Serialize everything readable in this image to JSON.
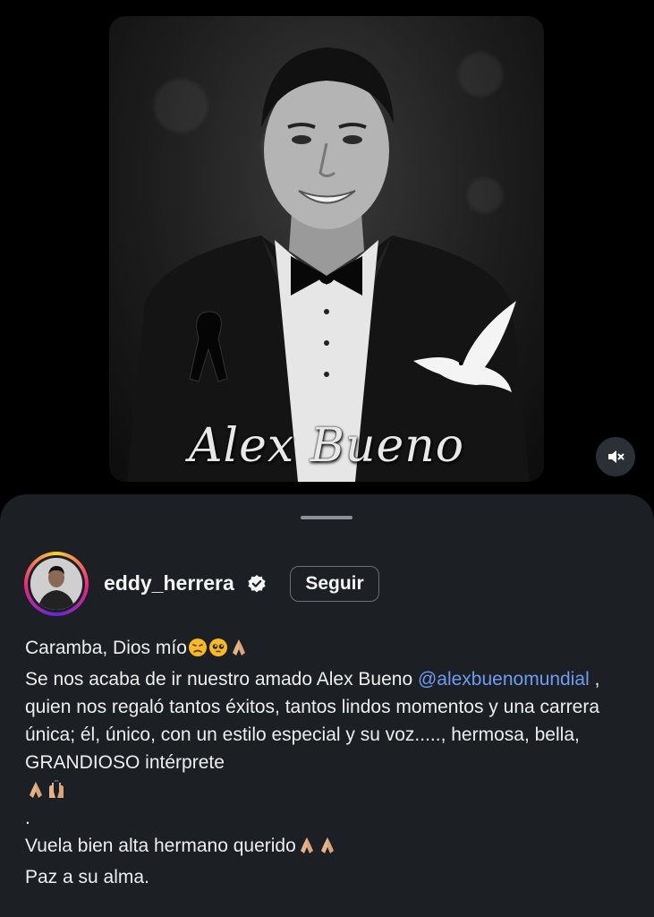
{
  "media": {
    "overlay_text": "Alex Bueno",
    "mute_icon": "speaker-muted-icon"
  },
  "post": {
    "username": "eddy_herrera",
    "verified_icon": "verified-badge-icon",
    "follow_label": "Seguir",
    "caption": {
      "line1": "Caramba, Dios mío",
      "line2_a": "Se nos acaba de ir nuestro amado Alex Bueno",
      "mention": "@alexbuenomundial",
      "line2_b": " , quien nos regaló tantos éxitos, tantos lindos momentos y una carrera única; él, único, con un estilo especial y su voz....., hermosa, bella, GRANDIOSO intérprete",
      "dot": ".",
      "line3": "Vuela bien alta hermano querido",
      "line4": "Paz a su alma."
    }
  },
  "colors": {
    "sheet_bg": "#1c1f24",
    "mention": "#6f9cf3",
    "verified": "#f5f5f5"
  }
}
